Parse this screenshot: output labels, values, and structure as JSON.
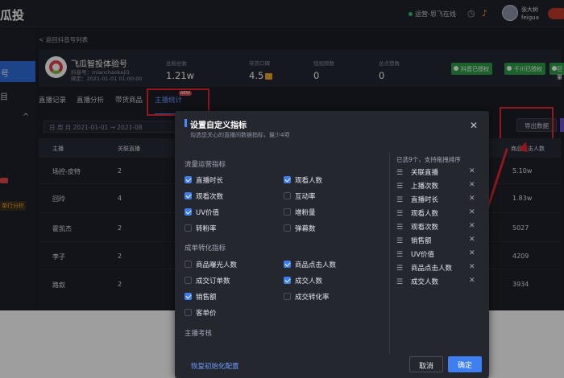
{
  "topbar": {
    "brand": "瓜投",
    "status": "运营-思飞在线",
    "user_name": "张大树",
    "user_id": "feigua"
  },
  "sidebar": {
    "active_label": "号",
    "item2": "目",
    "item3": "^",
    "tag": "单行分析"
  },
  "back_link": "< 返回抖音号列表",
  "account": {
    "name": "飞瓜智投体验号",
    "douyin_id": "抖音号：mianchaokeji1",
    "bind_time": "绑定：2021-01-01 01:00:00"
  },
  "stats": [
    {
      "label": "总粉丝数",
      "value": "1.21w"
    },
    {
      "label": "带货口碑",
      "value": "4.5"
    },
    {
      "label": "短视频数",
      "value": "0"
    },
    {
      "label": "总点赞数",
      "value": "0"
    }
  ],
  "auth_buttons": [
    "抖音已授权",
    "千川已授权",
    "巨量"
  ],
  "tabs": [
    "直播记录",
    "直播分析",
    "带货商品",
    "主播统计"
  ],
  "tab_new": "NEW",
  "filter": {
    "text": "日 周 月    2021-01-01  →  2021-08"
  },
  "export_label": "导出数据",
  "table": {
    "headers": [
      "主播",
      "关联直播",
      "商品点击人数"
    ],
    "rows": [
      {
        "name": "场控-皮特",
        "count": "2",
        "clicks": "5.10w"
      },
      {
        "name": "回玲",
        "count": "4",
        "clicks": "1.83w"
      },
      {
        "name": "霍凯杰",
        "count": "2",
        "clicks": "5027"
      },
      {
        "name": "李子",
        "count": "2",
        "clicks": "4209"
      },
      {
        "name": "路叙",
        "count": "2",
        "clicks": "3934"
      }
    ]
  },
  "modal": {
    "title": "设置自定义指标",
    "subtitle": "勾选您关心的直播间数据指标，最少4项",
    "section1": "流量运营指标",
    "section2": "成单转化指标",
    "section3": "主播考核",
    "options1": [
      {
        "label": "直播时长",
        "checked": true
      },
      {
        "label": "观看人数",
        "checked": true
      },
      {
        "label": "观看次数",
        "checked": true
      },
      {
        "label": "互动率",
        "checked": false
      },
      {
        "label": "UV价值",
        "checked": true
      },
      {
        "label": "增粉量",
        "checked": false
      },
      {
        "label": "转粉率",
        "checked": false
      },
      {
        "label": "弹幕数",
        "checked": false
      }
    ],
    "options2": [
      {
        "label": "商品曝光人数",
        "checked": false
      },
      {
        "label": "商品点击人数",
        "checked": true
      },
      {
        "label": "成交订单数",
        "checked": false
      },
      {
        "label": "成交人数",
        "checked": true
      },
      {
        "label": "销售额",
        "checked": true
      },
      {
        "label": "成交转化率",
        "checked": false
      },
      {
        "label": "客单价",
        "checked": false
      }
    ],
    "selected_title": "已选9个，支持拖拽排序",
    "selected": [
      "关联直播",
      "上播次数",
      "直播时长",
      "观看人数",
      "观看次数",
      "销售额",
      "UV价值",
      "商品点击人数",
      "成交人数"
    ],
    "reset": "恢复初始化配置",
    "cancel": "取消",
    "ok": "确定"
  }
}
